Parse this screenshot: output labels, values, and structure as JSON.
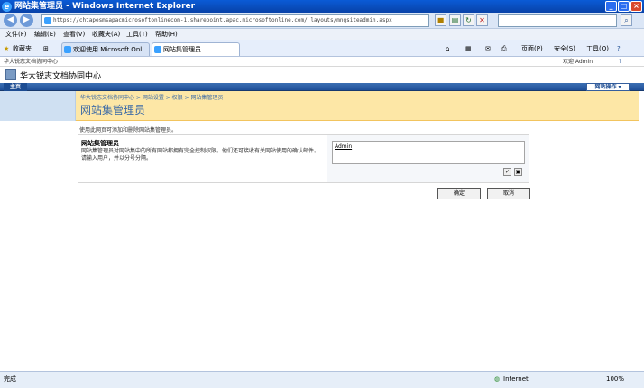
{
  "window": {
    "title": "网站集管理员 - Windows Internet Explorer",
    "min": "_",
    "max": "□",
    "close": "×"
  },
  "address": {
    "url": "https://chtapesmsapacmicrosoftonlinecom-1.sharepoint.apac.microsoftonline.com/_layouts/mngsiteadmin.aspx",
    "back": "◀",
    "forward": "▶",
    "go_icon": "↻",
    "stop_icon": "✕"
  },
  "menu": [
    "文件(F)",
    "编辑(E)",
    "查看(V)",
    "收藏夹(A)",
    "工具(T)",
    "帮助(H)"
  ],
  "favbar": {
    "favorites": "收藏夹",
    "tabs": [
      "欢迎使用 Microsoft Onl...",
      "网站集管理员"
    ],
    "commands": [
      "页面(P)",
      "安全(S)",
      "工具(O)"
    ]
  },
  "sp": {
    "top_left": "华大锐志文档协同中心",
    "welcome": "欢迎 Admin",
    "help": "?",
    "site_title": "华大锐志文档协同中心",
    "home_tab": "主页",
    "site_actions": "网站操作 ▾",
    "breadcrumb": "华大锐志文档协同中心 > 网站设置 > 权限 > 网站集管理员",
    "page_title": "网站集管理员",
    "page_desc": "使用此网页可添加和删除网站集管理员。",
    "section_title": "网站集管理员",
    "section_desc": "网站集管理员对网站集中的所有网站都拥有完全控制权限。他们还可接收有关网站使用的确认邮件。请输入用户，并以分号分隔。",
    "people_value": "Admin",
    "ok": "确定",
    "cancel": "取消"
  },
  "status": {
    "left": "完成",
    "zone": "Internet",
    "zoom": "100%"
  }
}
